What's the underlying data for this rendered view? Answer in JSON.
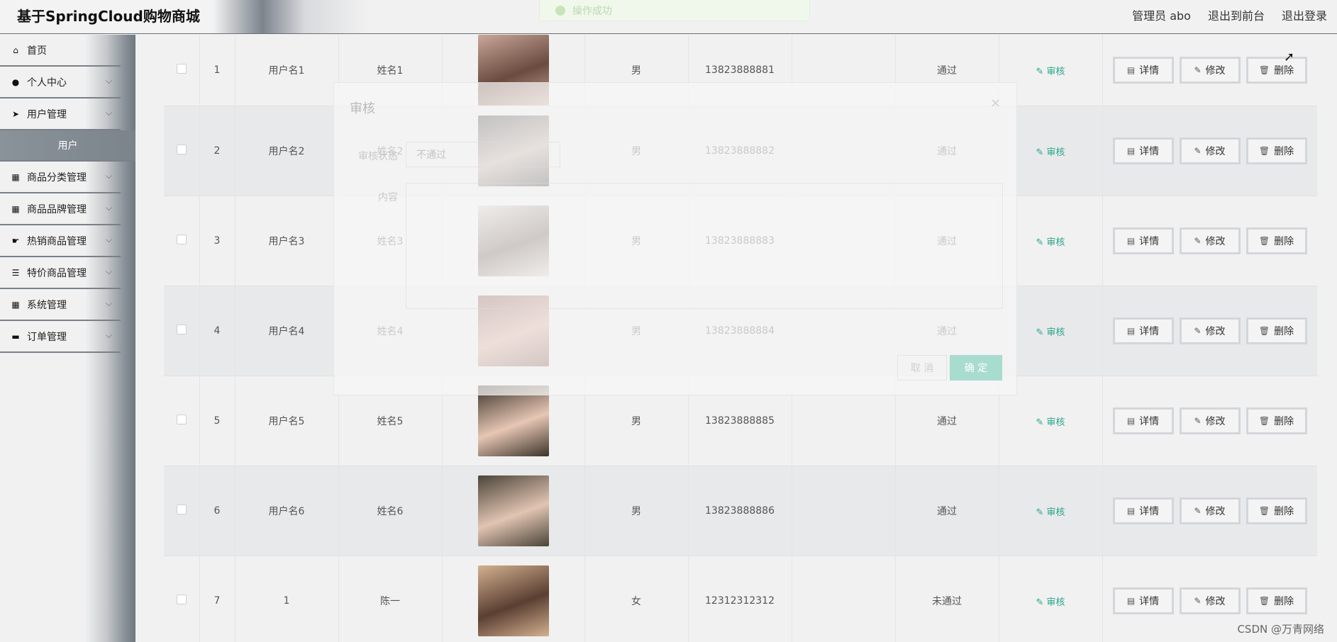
{
  "app": {
    "title": "基于SpringCloud购物商城",
    "user_label": "管理员 abo",
    "front_link": "退出到前台",
    "logout_link": "退出登录",
    "toast": "操作成功"
  },
  "sidebar": {
    "items": [
      {
        "label": "首页",
        "icon": "home-icon"
      },
      {
        "label": "个人中心",
        "icon": "person-icon"
      },
      {
        "label": "用户管理",
        "icon": "send-icon"
      }
    ],
    "active_sub": "用户",
    "items2": [
      {
        "label": "商品分类管理",
        "icon": "grid-icon"
      },
      {
        "label": "商品品牌管理",
        "icon": "grid-icon"
      },
      {
        "label": "热销商品管理",
        "icon": "hand-icon"
      },
      {
        "label": "特价商品管理",
        "icon": "sliders-icon"
      },
      {
        "label": "系统管理",
        "icon": "grid-icon"
      },
      {
        "label": "订单管理",
        "icon": "printer-icon"
      }
    ]
  },
  "table": {
    "rows": [
      {
        "index": "1",
        "username": "用户名1",
        "name": "姓名1",
        "gender": "男",
        "phone": "13823888881",
        "status": "通过",
        "photo_colors": [
          "#c9a79a",
          "#6a4b3f"
        ]
      },
      {
        "index": "2",
        "username": "用户名2",
        "name": "姓名2",
        "gender": "男",
        "phone": "13823888882",
        "status": "通过",
        "photo_colors": [
          "#3a3a3a",
          "#bfa79c"
        ]
      },
      {
        "index": "3",
        "username": "用户名3",
        "name": "姓名3",
        "gender": "男",
        "phone": "13823888883",
        "status": "通过",
        "photo_colors": [
          "#d9d2cb",
          "#6b554b"
        ]
      },
      {
        "index": "4",
        "username": "用户名4",
        "name": "姓名4",
        "gender": "男",
        "phone": "13823888884",
        "status": "通过",
        "photo_colors": [
          "#7a4a40",
          "#d4a08e"
        ]
      },
      {
        "index": "5",
        "username": "用户名5",
        "name": "姓名5",
        "gender": "男",
        "phone": "13823888885",
        "status": "通过",
        "photo_colors": [
          "#3b3429",
          "#e7c6b4"
        ]
      },
      {
        "index": "6",
        "username": "用户名6",
        "name": "姓名6",
        "gender": "男",
        "phone": "13823888886",
        "status": "通过",
        "photo_colors": [
          "#4a4438",
          "#e2c4b3"
        ]
      },
      {
        "index": "7",
        "username": "1",
        "name": "陈一",
        "gender": "女",
        "phone": "12312312312",
        "status": "未通过",
        "photo_colors": [
          "#d3b08f",
          "#5a3f32"
        ]
      }
    ],
    "audit_label": "审核",
    "detail_label": "详情",
    "edit_label": "修改",
    "delete_label": "删除"
  },
  "modal": {
    "title": "审核",
    "status_label": "审核状态",
    "status_value": "不通过",
    "content_label": "内容",
    "cancel": "取 消",
    "ok": "确 定"
  },
  "watermark": "CSDN @万青网络"
}
